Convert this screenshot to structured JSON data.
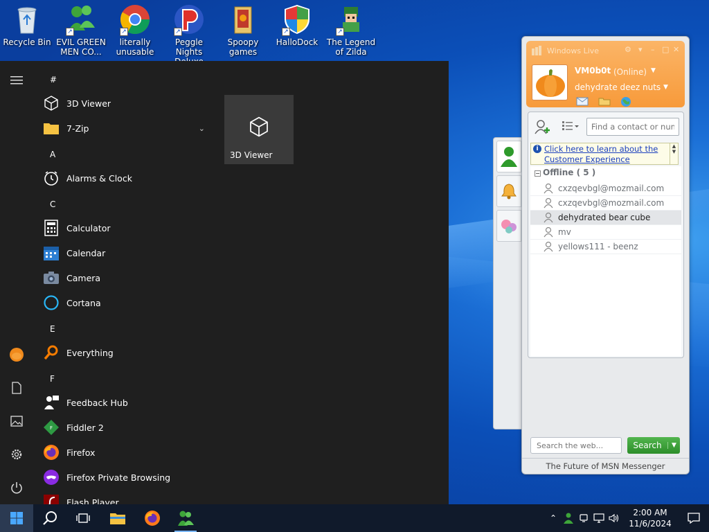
{
  "desktop": {
    "icons": [
      {
        "label": "Recycle Bin"
      },
      {
        "label": "EVIL GREEN MEN CO..."
      },
      {
        "label": "literally unusable"
      },
      {
        "label": "Peggle Nights Deluxe"
      },
      {
        "label": "Spoopy games"
      },
      {
        "label": "HalloDock"
      },
      {
        "label": "The Legend of Zilda"
      }
    ]
  },
  "start_menu": {
    "letters": [
      "#",
      "A",
      "C",
      "E",
      "F"
    ],
    "apps": [
      {
        "label": "3D Viewer"
      },
      {
        "label": "7-Zip"
      },
      {
        "label": "Alarms & Clock"
      },
      {
        "label": "Calculator"
      },
      {
        "label": "Calendar"
      },
      {
        "label": "Camera"
      },
      {
        "label": "Cortana"
      },
      {
        "label": "Everything"
      },
      {
        "label": "Feedback Hub"
      },
      {
        "label": "Fiddler 2"
      },
      {
        "label": "Firefox"
      },
      {
        "label": "Firefox Private Browsing"
      },
      {
        "label": "Flash Player"
      }
    ],
    "tile": {
      "label": "3D Viewer"
    }
  },
  "msn": {
    "brand": "Windows Live",
    "user": {
      "name": "VM0b0t",
      "status": "(Online)",
      "message": "dehydrate deez nuts"
    },
    "find_placeholder": "Find a contact or num",
    "notice": "Click here to learn about the Customer Experience",
    "group": "Offline ( 5 )",
    "contacts": [
      {
        "name": "cxzqevbgl@mozmail.com"
      },
      {
        "name": "cxzqevbgl@mozmail.com"
      },
      {
        "name": "dehydrated bear cube"
      },
      {
        "name": "mv"
      },
      {
        "name": "yellows111 - beenz"
      }
    ],
    "search_placeholder": "Search the web...",
    "search_button": "Search",
    "footer": "The Future of MSN Messenger"
  },
  "taskbar": {
    "time": "2:00 AM",
    "date": "11/6/2024"
  },
  "colors": {
    "start_bg": "#1f1f1f",
    "taskbar_bg": "#101a2b",
    "msn_orange": "#f79a3a",
    "link_blue": "#1b3fbd",
    "search_green": "#2c8e2a"
  }
}
